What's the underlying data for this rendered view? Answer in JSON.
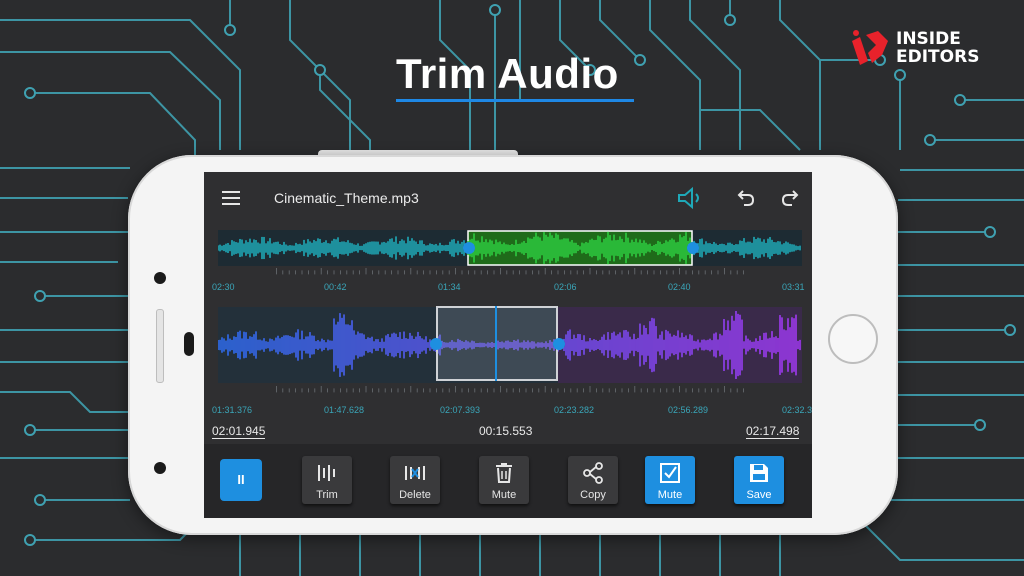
{
  "headline": {
    "title": "Trim Audio"
  },
  "brand": {
    "line1": "INSIDE",
    "line2": "EDITORS"
  },
  "colors": {
    "accent": "#1e8fe0",
    "selection_green": "#2ecc40",
    "wave_cyan": "#1fa9b8",
    "wave_blue": "#2e6df0",
    "wave_purple": "#a238f2",
    "background": "#2b2c2e"
  },
  "app": {
    "menu_icon": "hamburger-icon",
    "filename": "Cinematic_Theme.mp3",
    "volume_icon": "volume-icon",
    "undo_icon": "undo-icon",
    "redo_icon": "redo-icon"
  },
  "overview": {
    "ticks": [
      "02:30",
      "00:42",
      "01:34",
      "02:06",
      "02:40",
      "03:31"
    ]
  },
  "detail": {
    "ticks": [
      "01:31.376",
      "01:47.628",
      "02:07.393",
      "02:23.282",
      "02:56.289",
      "02:32.3"
    ]
  },
  "times": {
    "start": "02:01.945",
    "duration": "00:15.553",
    "end": "02:17.498"
  },
  "toolbar": {
    "pause": {
      "label": "II",
      "icon": "pause-icon"
    },
    "trim": {
      "label": "Trim",
      "icon": "trim-icon"
    },
    "delete": {
      "label": "Delete",
      "icon": "delete-icon"
    },
    "mute": {
      "label": "Mute",
      "icon": "trash-icon"
    },
    "copy": {
      "label": "Copy",
      "icon": "share-icon"
    },
    "mute_active": {
      "label": "Mute",
      "icon": "checkbox-icon"
    },
    "save": {
      "label": "Save",
      "icon": "floppy-disk-icon"
    }
  }
}
